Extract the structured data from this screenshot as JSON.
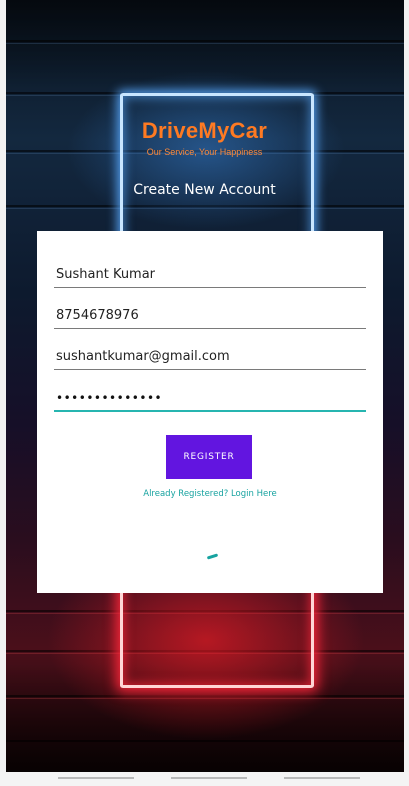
{
  "header": {
    "brand": "DriveMyCar",
    "tagline": "Our Service, Your Happiness",
    "screen_title": "Create New Account"
  },
  "form": {
    "name_value": "Sushant Kumar",
    "phone_value": "8754678976",
    "email_value": "sushantkumar@gmail.com",
    "password_mask": "••••••••••••••",
    "register_label": "REGISTER",
    "login_link": "Already Registered? Login Here"
  },
  "colors": {
    "brand": "#ff7a22",
    "button": "#6215e0",
    "accent": "#26b5b0"
  },
  "icons": {
    "loading": "progress-spinner"
  }
}
